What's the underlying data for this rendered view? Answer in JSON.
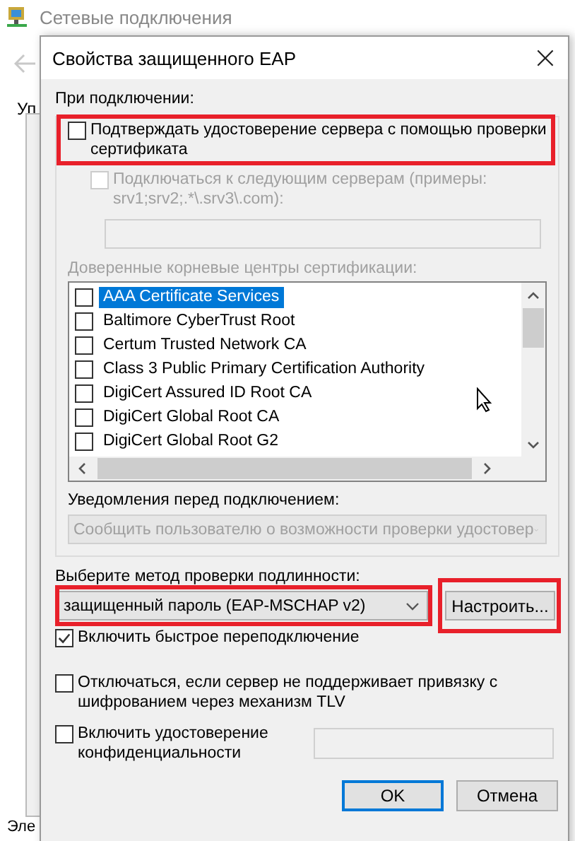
{
  "background_window": {
    "title": "Сетевые подключения",
    "partial_label": "Уп",
    "bottom_label": "Эле"
  },
  "dialog": {
    "title": "Свойства защищенного EAP",
    "close": "×"
  },
  "connect_group": {
    "label": "При подключении:",
    "verify_server": {
      "label": "Подтверждать удостоверение сервера с помощью проверки сертификата",
      "checked": false,
      "highlighted": true
    },
    "connect_servers": {
      "label": "Подключаться к следующим серверам (примеры: srv1;srv2;.*\\.srv3\\.com):",
      "checked": false,
      "disabled": true
    },
    "trusted_label": "Доверенные корневые центры сертификации:",
    "trusted_cas": [
      {
        "name": "AAA Certificate Services",
        "checked": false,
        "selected": true
      },
      {
        "name": "Baltimore CyberTrust Root",
        "checked": false,
        "selected": false
      },
      {
        "name": "Certum Trusted Network CA",
        "checked": false,
        "selected": false
      },
      {
        "name": "Class 3 Public Primary Certification Authority",
        "checked": false,
        "selected": false
      },
      {
        "name": "DigiCert Assured ID Root CA",
        "checked": false,
        "selected": false
      },
      {
        "name": "DigiCert Global Root CA",
        "checked": false,
        "selected": false
      },
      {
        "name": "DigiCert Global Root G2",
        "checked": false,
        "selected": false
      }
    ],
    "notify_label": "Уведомления перед подключением:",
    "notify_value": "Сообщить пользователю о возможности проверки удостовер"
  },
  "auth_method": {
    "label": "Выберите метод проверки подлинности:",
    "value": "защищенный пароль (EAP-MSCHAP v2)",
    "highlighted": true
  },
  "configure_button": {
    "label": "Настроить...",
    "highlighted": true
  },
  "options": [
    {
      "label": "Включить быстрое переподключение",
      "checked": true
    },
    {
      "label": "Отключаться, если сервер не поддерживает привязку с шифрованием через механизм TLV",
      "checked": false
    },
    {
      "label": "Включить удостоверение конфиденциальности",
      "checked": false
    }
  ],
  "buttons": [
    {
      "label": "OK",
      "default": true
    },
    {
      "label": "Отмена",
      "default": false
    }
  ]
}
